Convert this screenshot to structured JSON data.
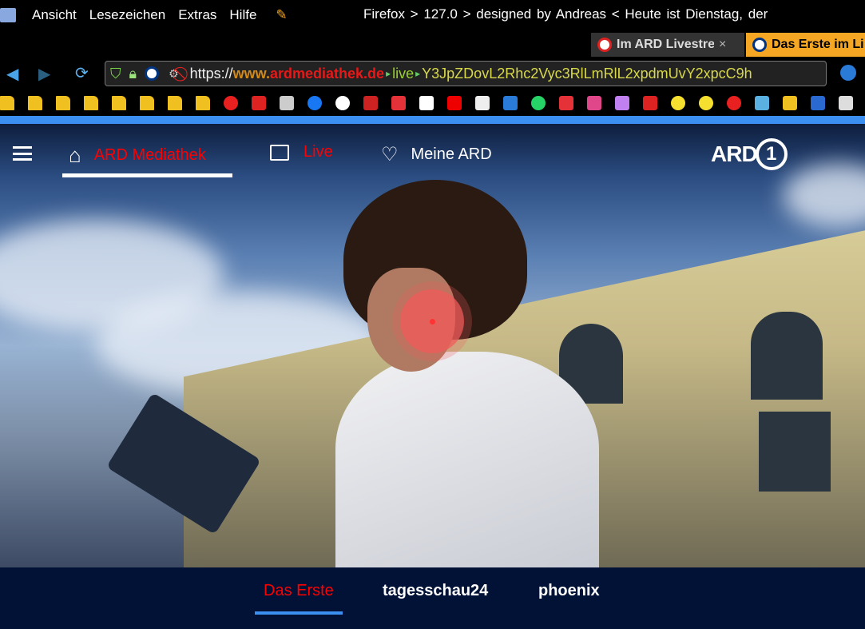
{
  "menubar": {
    "items": [
      "Ansicht",
      "Lesezeichen",
      "Extras",
      "Hilfe"
    ],
    "title": "Firefox  >  127.0  >  designed by Andreas  <  Heute ist Dienstag, der"
  },
  "tabs": [
    {
      "label": "Im ARD Livestre",
      "close": "×"
    },
    {
      "label": "Das Erste im Li"
    }
  ],
  "url": {
    "scheme": "https://",
    "host_www": "www.",
    "host_main": "ardmediathek.de",
    "sep": "▸",
    "path1": "live",
    "path2": "Y3JpZDovL2Rhc2Vyc3RlLmRlL2xpdmUvY2xpcC9h"
  },
  "bookmarks": [
    "folder",
    "folder",
    "folder",
    "folder",
    "folder",
    "folder",
    "folder",
    "folder",
    "flame",
    "youtube",
    "bz",
    "facebook",
    "at-sign",
    "news",
    "ebay",
    "amazon",
    "sparkasse",
    "gh",
    "monitor",
    "whatsapp",
    "ebay",
    "cloud",
    "people",
    "red-box",
    "smiley",
    "smiley",
    "flame",
    "beach",
    "diamond",
    "cb",
    "doc"
  ],
  "colors": {
    "accent": "#3a8ff0",
    "active": "#ff0000",
    "bottom_bg": "#021236"
  },
  "nav": {
    "home": "ARD Mediathek",
    "live": "Live",
    "mine": "Meine ARD",
    "logo": "ARD"
  },
  "channels": [
    "Das Erste",
    "tagesschau24",
    "phoenix"
  ]
}
